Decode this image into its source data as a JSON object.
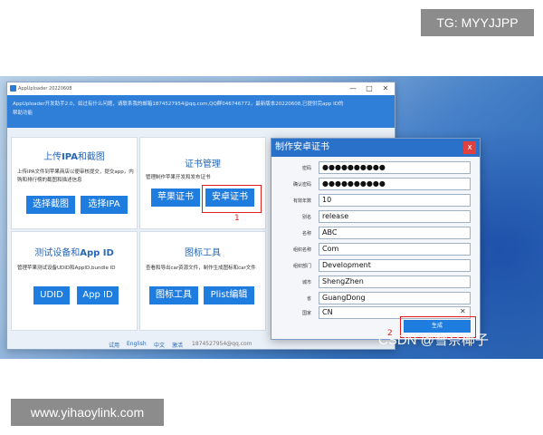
{
  "watermarks": {
    "top": "TG: MYYJJPP",
    "bottom": "www.yihaoylink.com",
    "csdn": "CSDN @雪奈椰子"
  },
  "window": {
    "title": "AppUploader 20220608",
    "controls": {
      "minimize": "—",
      "maximize": "□",
      "close": "✕"
    },
    "notice_line1": "AppUploader开发助手2.0，如过有什么问题，请联系我的邮箱1874527954@qq.com,QQ群046746772，最新版本20220608,已提供完app ID的",
    "notice_line2": "帮助功能"
  },
  "panels": {
    "upload": {
      "title_prefix": "上传",
      "title_bold": "IPA",
      "title_suffix": "和截图",
      "desc": "上传IPA文件到苹果商店以便审核提交，提交app，内购和排行榜的截图和描述信息",
      "btn1": "选择截图",
      "btn2": "选择IPA"
    },
    "cert": {
      "title": "证书管理",
      "desc": "管理制作苹果开发和发布证书",
      "btn1": "苹果证书",
      "btn2": "安卓证书",
      "tag": "1"
    },
    "device": {
      "title_prefix": "测试设备和",
      "title_bold": "App ID",
      "desc": "管理苹果测试设备UDID和AppID,bundle ID",
      "btn1": "UDID",
      "btn2": "App ID"
    },
    "icon": {
      "title": "图标工具",
      "desc": "查看和导出car资源文件，制作生成图标和car文件",
      "btn1": "图标工具",
      "btn2": "Plist编辑"
    }
  },
  "footer": {
    "items": [
      "试用",
      "English",
      "中文",
      "激活"
    ],
    "email": "1874527954@qq.com"
  },
  "dialog": {
    "title": "制作安卓证书",
    "close": "x",
    "fields": [
      {
        "label": "密码",
        "value": "●●●●●●●●●●"
      },
      {
        "label": "确认密码",
        "value": "●●●●●●●●●●"
      },
      {
        "label": "有效年数",
        "value": "10"
      },
      {
        "label": "别名",
        "value": "release"
      },
      {
        "label": "名称",
        "value": "ABC"
      },
      {
        "label": "组织名称",
        "value": "Com"
      },
      {
        "label": "组织部门",
        "value": "Development"
      },
      {
        "label": "城市",
        "value": "ShengZhen"
      },
      {
        "label": "省",
        "value": "GuangDong"
      },
      {
        "label": "国家",
        "value": "CN"
      }
    ],
    "clear": "✕",
    "generate": "生成",
    "tag": "2"
  }
}
